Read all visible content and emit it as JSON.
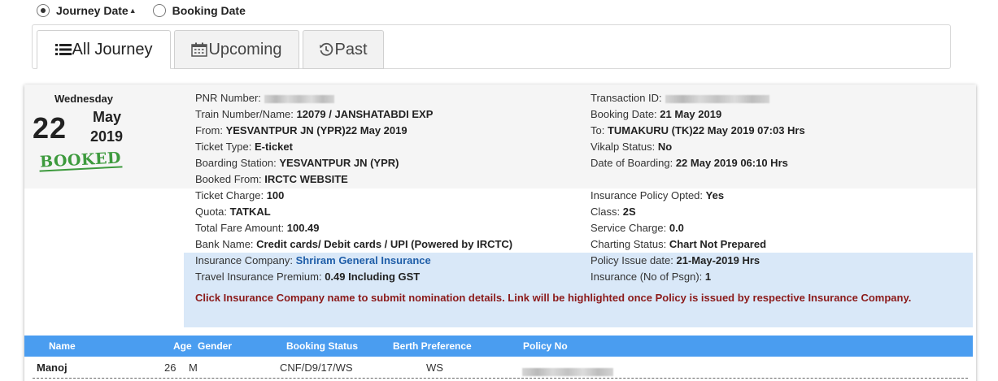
{
  "filter": {
    "options": [
      {
        "label": "Journey Date",
        "checked": true,
        "sort_icon": "triangle-up-icon"
      },
      {
        "label": "Booking Date",
        "checked": false
      }
    ]
  },
  "tabs": [
    {
      "label": "All Journey",
      "icon": "list-icon",
      "active": true
    },
    {
      "label": "Upcoming",
      "icon": "calendar-icon",
      "active": false
    },
    {
      "label": "Past",
      "icon": "history-icon",
      "active": false
    }
  ],
  "ticket": {
    "weekday": "Wednesday",
    "day": "22",
    "month": "May",
    "year": "2019",
    "status_stamp": "BOOKED",
    "left_fields": [
      {
        "key": "PNR Number:",
        "value": ""
      },
      {
        "key": "Train Number/Name:",
        "value": "12079 / JANSHATABDI EXP"
      },
      {
        "key": "From:",
        "value": "YESVANTPUR JN (YPR)22 May 2019"
      },
      {
        "key": "Ticket Type:",
        "value": "E-ticket"
      },
      {
        "key": "Boarding Station:",
        "value": "YESVANTPUR JN (YPR)"
      },
      {
        "key": "Booked From:",
        "value": "IRCTC WEBSITE"
      },
      {
        "key": "Ticket Charge:",
        "value": "100"
      },
      {
        "key": "Quota:",
        "value": "TATKAL"
      },
      {
        "key": "Total Fare Amount:",
        "value": "100.49"
      },
      {
        "key": "Bank Name:",
        "value": "Credit cards/ Debit cards / UPI (Powered by IRCTC)"
      },
      {
        "key": "Insurance Company:",
        "value": "Shriram General Insurance"
      },
      {
        "key": "Travel Insurance Premium:",
        "value": "0.49 Including GST"
      }
    ],
    "right_fields": [
      {
        "key": "Transaction ID:",
        "value": ""
      },
      {
        "key": "Booking Date:",
        "value": "21 May 2019"
      },
      {
        "key": "To:",
        "value": "TUMAKURU (TK)22 May 2019 07:03 Hrs"
      },
      {
        "key": "Vikalp Status:",
        "value": "No"
      },
      {
        "key": "Date of Boarding:",
        "value": "22 May 2019 06:10 Hrs"
      },
      {
        "key": "Insurance Policy Opted:",
        "value": "Yes"
      },
      {
        "key": "Class:",
        "value": "2S"
      },
      {
        "key": "Service Charge:",
        "value": "0.0"
      },
      {
        "key": "Charting Status:",
        "value": "Chart Not Prepared"
      },
      {
        "key": "Policy Issue date:",
        "value": "21-May-2019 Hrs"
      },
      {
        "key": "Insurance (No of Psgn):",
        "value": "1"
      }
    ],
    "insurance_note": "Click Insurance Company name to submit nomination details. Link will be highlighted once Policy is issued by respective Insurance Company."
  },
  "passenger_table": {
    "headers": [
      "Name",
      "Age",
      "Gender",
      "Booking Status",
      "Berth Preference",
      "Policy No"
    ],
    "rows": [
      {
        "name": "Manoj",
        "age": "26",
        "gender": "M",
        "booking_status": "CNF/D9/17/WS",
        "berth": "WS",
        "policy_no": ""
      }
    ]
  },
  "colors": {
    "header_blue": "#4a9df0",
    "insurance_band": "#d9e8f8",
    "note_red": "#8b1a1a",
    "link_blue": "#1f5ea8",
    "stamp_green": "#3d9a3d"
  }
}
